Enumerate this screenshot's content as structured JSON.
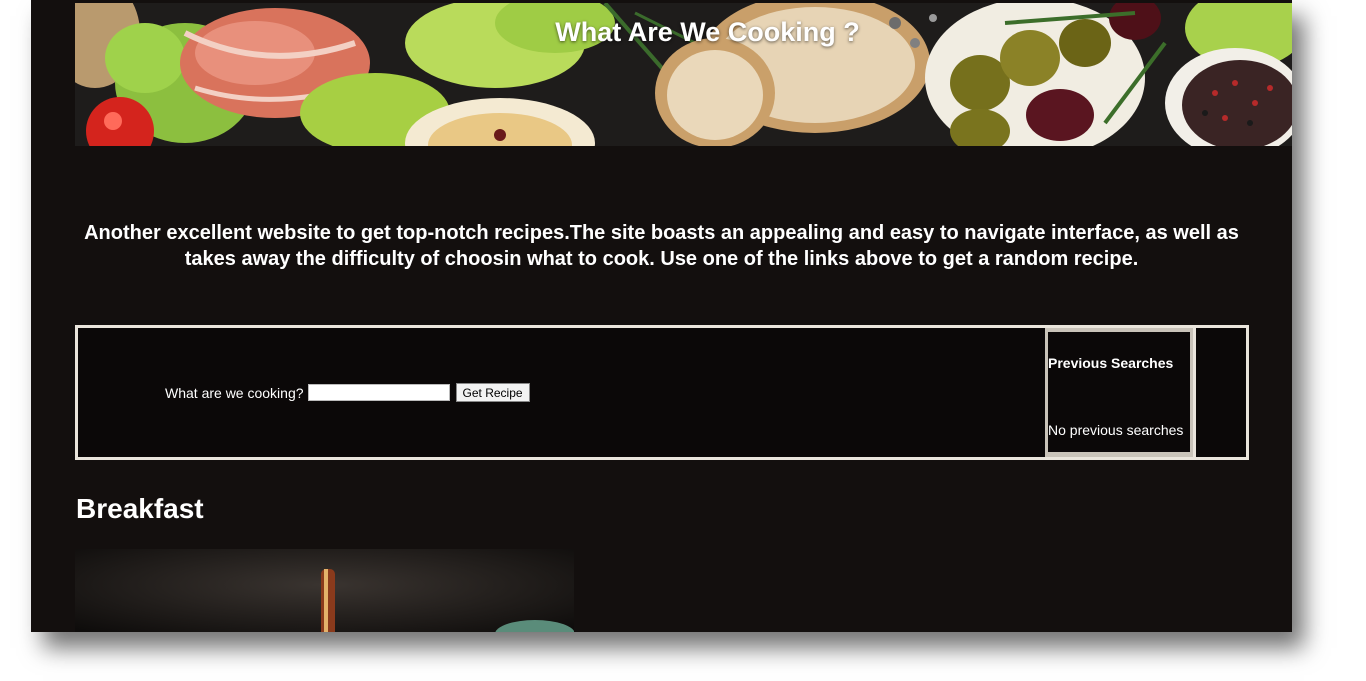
{
  "header": {
    "title": "What Are We Cooking ?"
  },
  "intro": {
    "text": "Another excellent website to get top-notch recipes.The site boasts an appealing and easy to navigate interface, as well as takes away the difficulty of choosin what to cook. Use one of the links above to get a random recipe."
  },
  "search": {
    "label": "What are we cooking?",
    "input_value": "",
    "button_label": "Get Recipe"
  },
  "previous_searches": {
    "title": "Previous Searches",
    "empty_text": "No previous searches"
  },
  "sections": {
    "breakfast": {
      "heading": "Breakfast"
    }
  },
  "colors": {
    "page_background": "#130f0e",
    "border": "#eae5dc",
    "text": "#ffffff"
  }
}
